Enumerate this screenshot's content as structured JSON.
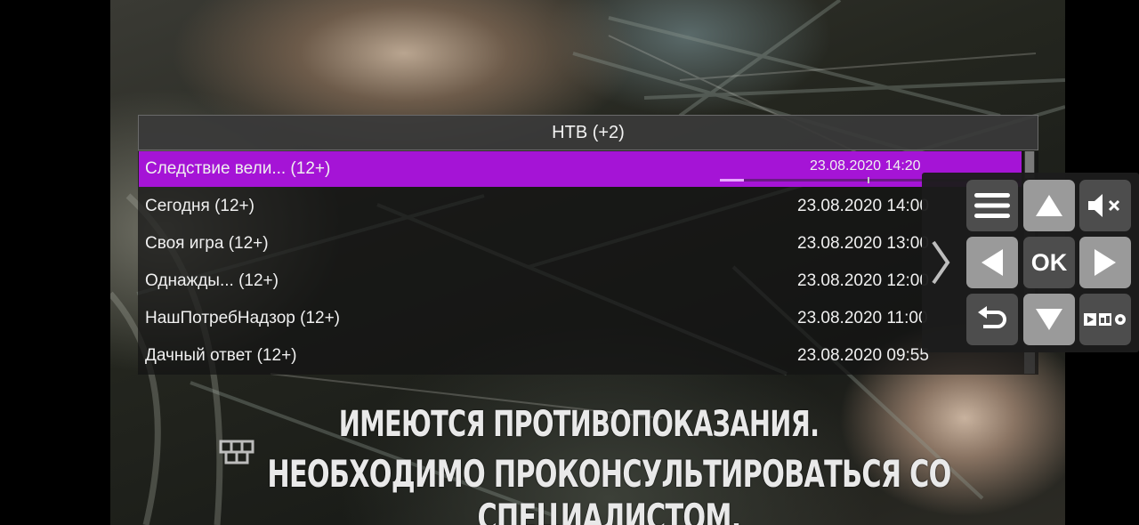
{
  "channel": {
    "header": "НТВ (+2)"
  },
  "programs": [
    {
      "title": "Следствие вели... (12+)",
      "time": "23.08.2020 14:20",
      "selected": true,
      "progress": 0.08
    },
    {
      "title": "Сегодня (12+)",
      "time": "23.08.2020 14:00",
      "selected": false
    },
    {
      "title": "Своя игра (12+)",
      "time": "23.08.2020 13:00",
      "selected": false
    },
    {
      "title": "Однажды... (12+)",
      "time": "23.08.2020 12:00",
      "selected": false
    },
    {
      "title": "НашПотребНадзор (12+)",
      "time": "23.08.2020 11:00",
      "selected": false
    },
    {
      "title": "Дачный ответ (12+)",
      "time": "23.08.2020 09:55",
      "selected": false
    }
  ],
  "video": {
    "subtitle_line1": "ИМЕЮТСЯ ПРОТИВОПОКАЗАНИЯ.",
    "subtitle_line2": "НЕОБХОДИМО ПРОКОНСУЛЬТИРОВАТЬСЯ СО СПЕЦИАЛИСТОМ."
  },
  "remote": {
    "ok_label": "OK",
    "icons": {
      "menu": "menu-icon",
      "up": "arrow-up-icon",
      "mute": "mute-icon",
      "left": "arrow-left-icon",
      "right": "arrow-right-icon",
      "back": "back-icon",
      "down": "arrow-down-icon",
      "media": "media-controls-icon",
      "expand": "chevron-right-icon"
    }
  },
  "colors": {
    "selection": "#a514d6",
    "progress_fill": "#e7a8ff",
    "button_dark": "#4d4d4d",
    "button_light": "#9a9a9a"
  }
}
